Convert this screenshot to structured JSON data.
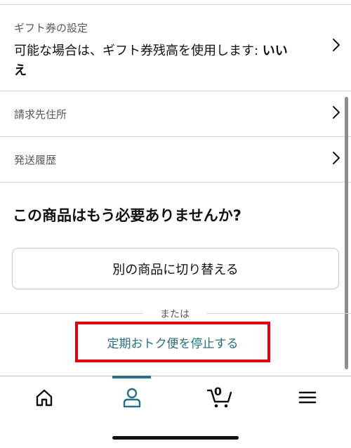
{
  "gift_settings": {
    "caption": "ギフト券の設定",
    "value_text": "可能な場合は、ギフト券残高を使用します: ",
    "value_bold": "いいえ"
  },
  "billing": {
    "label": "請求先住所"
  },
  "history": {
    "label": "発送履歴"
  },
  "question": "この商品はもう必要ありませんか?",
  "switch_button": "別の商品に切り替える",
  "divider_text": "または",
  "stop_link": "定期おトク便を停止する",
  "cart": {
    "count": "0"
  },
  "colors": {
    "link": "#2a6f84",
    "highlight": "#e40013",
    "active_tab": "#2a6f84"
  },
  "nav": {
    "active": "account",
    "items": [
      "home-icon",
      "account-icon",
      "cart-icon",
      "menu-icon"
    ]
  }
}
